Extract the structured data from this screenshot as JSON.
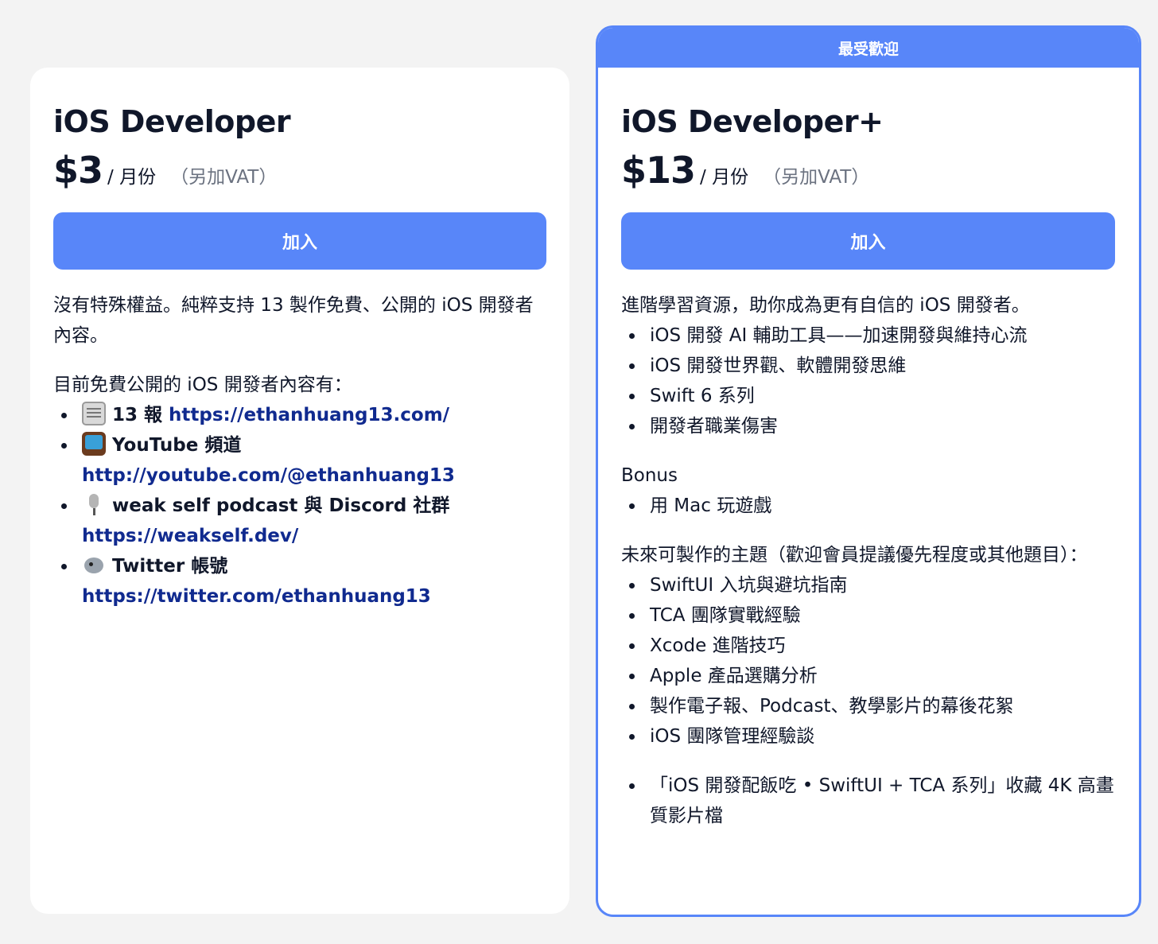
{
  "basic": {
    "title": "iOS Developer",
    "price": "$3",
    "period": "/ 月份",
    "vat": "（另加VAT）",
    "join_label": "加入",
    "description": "沒有特殊權益。純粹支持 13 製作免費、公開的 iOS 開發者內容。",
    "content_intro": "目前免費公開的 iOS 開發者內容有：",
    "items": [
      {
        "icon": "newspaper-icon",
        "label": "13 報",
        "link": "https://ethanhuang13.com/"
      },
      {
        "icon": "television-icon",
        "label": "YouTube 頻道",
        "link": "http://youtube.com/@ethanhuang13"
      },
      {
        "icon": "microphone-icon",
        "label": "weak self podcast 與 Discord 社群",
        "link": "https://weakself.dev/"
      },
      {
        "icon": "bird-icon",
        "label": "Twitter 帳號",
        "link": "https://twitter.com/ethanhuang13"
      }
    ]
  },
  "plus": {
    "badge": "最受歡迎",
    "title": "iOS Developer+",
    "price": "$13",
    "period": "/ 月份",
    "vat": "（另加VAT）",
    "join_label": "加入",
    "description": "進階學習資源，助你成為更有自信的 iOS 開發者。",
    "features": [
      "iOS 開發 AI 輔助工具——加速開發與維持心流",
      "iOS 開發世界觀、軟體開發思維",
      "Swift 6 系列",
      "開發者職業傷害"
    ],
    "bonus_title": "Bonus",
    "bonus_items": [
      "用 Mac 玩遊戲"
    ],
    "future_intro": "未來可製作的主題（歡迎會員提議優先程度或其他題目）：",
    "future_items": [
      "SwiftUI 入坑與避坑指南",
      "TCA 團隊實戰經驗",
      "Xcode 進階技巧",
      "Apple 產品選購分析",
      "製作電子報、Podcast、教學影片的幕後花絮",
      "iOS 團隊管理經驗談"
    ],
    "final_items": [
      "「iOS 開發配飯吃 • SwiftUI + TCA 系列」收藏 4K 高畫質影片檔"
    ]
  },
  "colors": {
    "accent": "#5886f9",
    "text": "#10172a",
    "link": "#102a8f",
    "muted": "#6b7280",
    "background": "#f3f3f3"
  }
}
